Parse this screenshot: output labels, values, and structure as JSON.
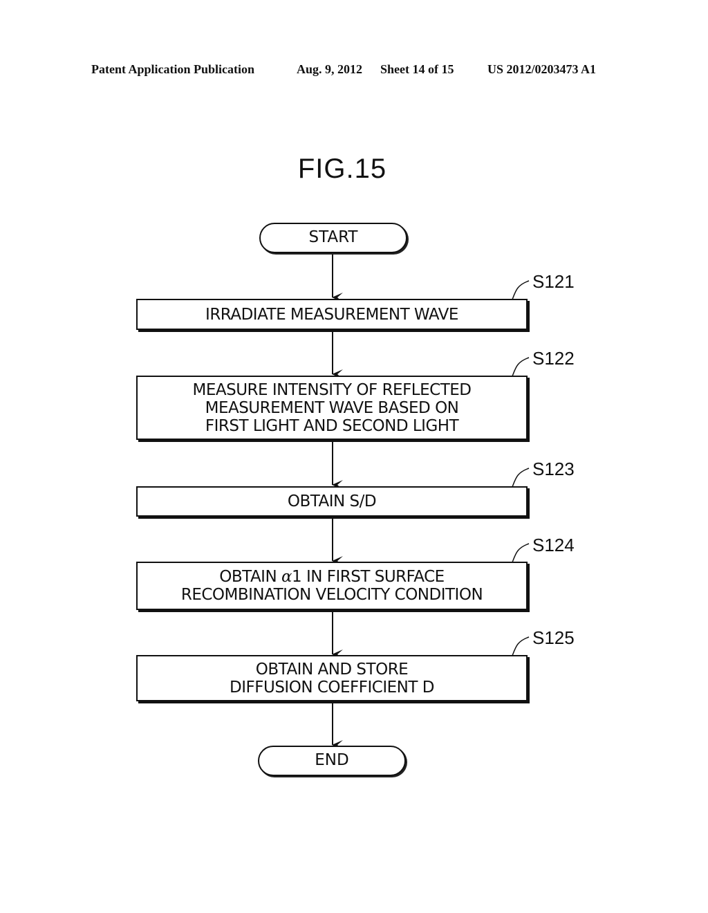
{
  "header": {
    "publication": "Patent Application Publication",
    "date": "Aug. 9, 2012",
    "sheet": "Sheet 14 of 15",
    "number": "US 2012/0203473 A1"
  },
  "figure": {
    "title": "FIG.15"
  },
  "flowchart": {
    "start": "START",
    "end": "END",
    "steps": [
      {
        "id": "S121",
        "lines": [
          "IRRADIATE MEASUREMENT WAVE"
        ]
      },
      {
        "id": "S122",
        "lines": [
          "MEASURE INTENSITY OF REFLECTED",
          "MEASUREMENT WAVE BASED ON",
          "FIRST LIGHT AND SECOND LIGHT"
        ]
      },
      {
        "id": "S123",
        "lines": [
          "OBTAIN S/D"
        ]
      },
      {
        "id": "S124",
        "lines_parts": {
          "prefix": "OBTAIN ",
          "symbol": "α",
          "suffix": "1 IN FIRST SURFACE"
        },
        "lines": [
          "RECOMBINATION VELOCITY CONDITION"
        ]
      },
      {
        "id": "S125",
        "lines": [
          "OBTAIN AND STORE",
          "DIFFUSION COEFFICIENT D"
        ]
      }
    ]
  }
}
